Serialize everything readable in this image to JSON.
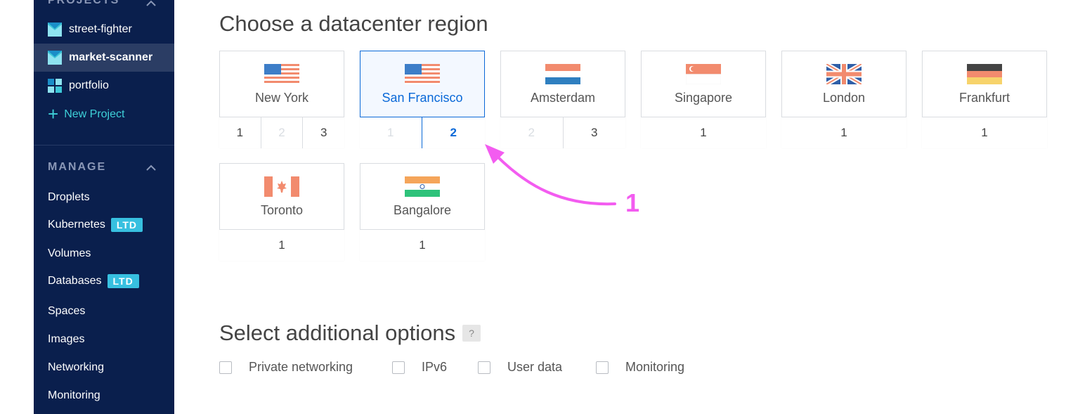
{
  "sidebar": {
    "projects_header": "PROJECTS",
    "projects": [
      {
        "label": "street-fighter",
        "icon": "project-icon"
      },
      {
        "label": "market-scanner",
        "icon": "project-icon",
        "active": true
      },
      {
        "label": "portfolio",
        "icon": "project-icon"
      }
    ],
    "new_project_label": "New Project",
    "manage_header": "MANAGE",
    "manage_items": [
      {
        "label": "Droplets"
      },
      {
        "label": "Kubernetes",
        "badge": "LTD"
      },
      {
        "label": "Volumes"
      },
      {
        "label": "Databases",
        "badge": "LTD"
      },
      {
        "label": "Spaces"
      },
      {
        "label": "Images"
      },
      {
        "label": "Networking"
      },
      {
        "label": "Monitoring"
      }
    ]
  },
  "region": {
    "title": "Choose a datacenter region",
    "cards": [
      {
        "city": "New York",
        "flag": "us-flag-icon",
        "numbers": [
          {
            "n": "1",
            "state": "enabled"
          },
          {
            "n": "2",
            "state": "disabled"
          },
          {
            "n": "3",
            "state": "enabled"
          }
        ]
      },
      {
        "city": "San Francisco",
        "flag": "us-flag-icon",
        "selected": true,
        "numbers": [
          {
            "n": "1",
            "state": "disabled"
          },
          {
            "n": "2",
            "state": "selected"
          }
        ]
      },
      {
        "city": "Amsterdam",
        "flag": "netherlands-flag-icon",
        "numbers": [
          {
            "n": "2",
            "state": "disabled"
          },
          {
            "n": "3",
            "state": "enabled"
          }
        ]
      },
      {
        "city": "Singapore",
        "flag": "singapore-flag-icon",
        "numbers": [
          {
            "n": "1",
            "state": "enabled"
          }
        ]
      },
      {
        "city": "London",
        "flag": "uk-flag-icon",
        "numbers": [
          {
            "n": "1",
            "state": "enabled"
          }
        ]
      },
      {
        "city": "Frankfurt",
        "flag": "germany-flag-icon",
        "numbers": [
          {
            "n": "1",
            "state": "enabled"
          }
        ]
      },
      {
        "city": "Toronto",
        "flag": "canada-flag-icon",
        "numbers": [
          {
            "n": "1",
            "state": "enabled"
          }
        ]
      },
      {
        "city": "Bangalore",
        "flag": "india-flag-icon",
        "numbers": [
          {
            "n": "1",
            "state": "enabled"
          }
        ]
      }
    ]
  },
  "annotation": {
    "label": "1",
    "color": "#f35cf0"
  },
  "options": {
    "title": "Select additional options",
    "help_label": "?",
    "items": [
      {
        "label": "Private networking",
        "checked": false
      },
      {
        "label": "IPv6",
        "checked": false
      },
      {
        "label": "User data",
        "checked": false
      },
      {
        "label": "Monitoring",
        "checked": false
      }
    ]
  },
  "colors": {
    "sidebar_bg": "#0a1f4d",
    "accent": "#0a69d8",
    "badge": "#37c0e0",
    "new_project": "#3ed0d8"
  }
}
